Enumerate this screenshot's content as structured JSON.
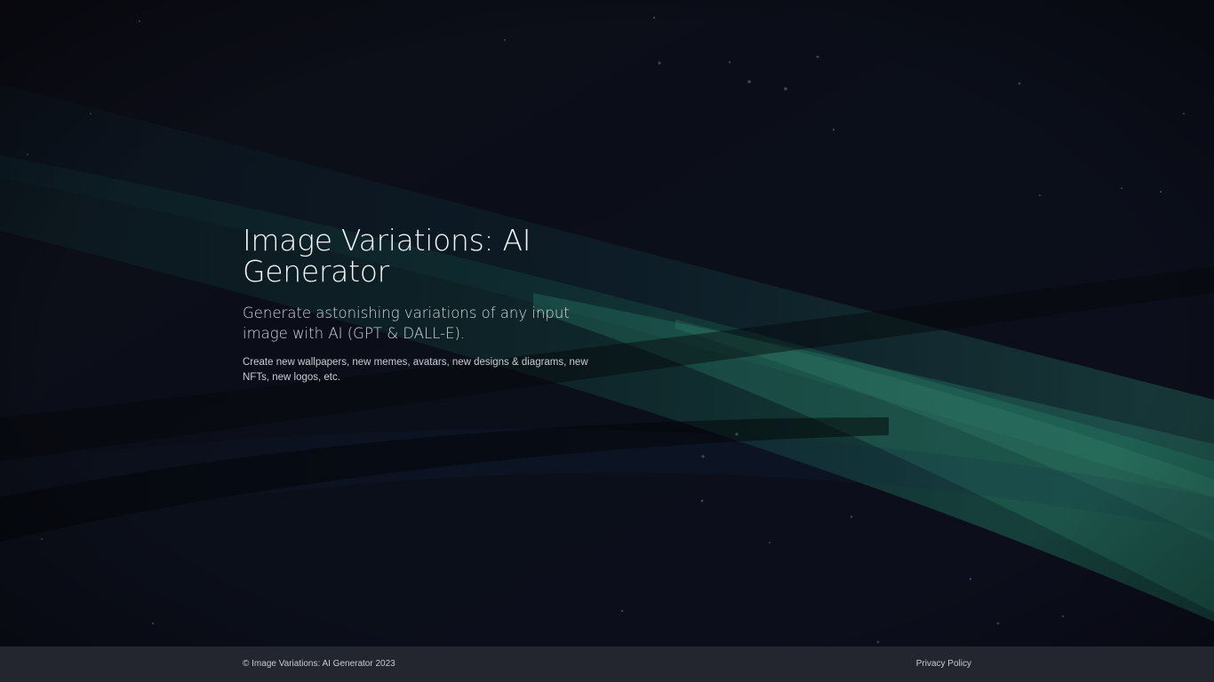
{
  "hero": {
    "title": "Image Variations: AI Generator",
    "subtitle": "Generate astonishing variations of any input image with AI (GPT & DALL-E).",
    "description": "Create new wallpapers, new memes, avatars, new designs & diagrams, new NFTs, new logos, etc."
  },
  "footer": {
    "copyright": "© Image Variations: AI Generator 2023",
    "privacy_link": "Privacy Policy"
  },
  "colors": {
    "background": "#0c0d17",
    "accent_green": "#1f6a58",
    "footer_bg": "#24262f"
  }
}
